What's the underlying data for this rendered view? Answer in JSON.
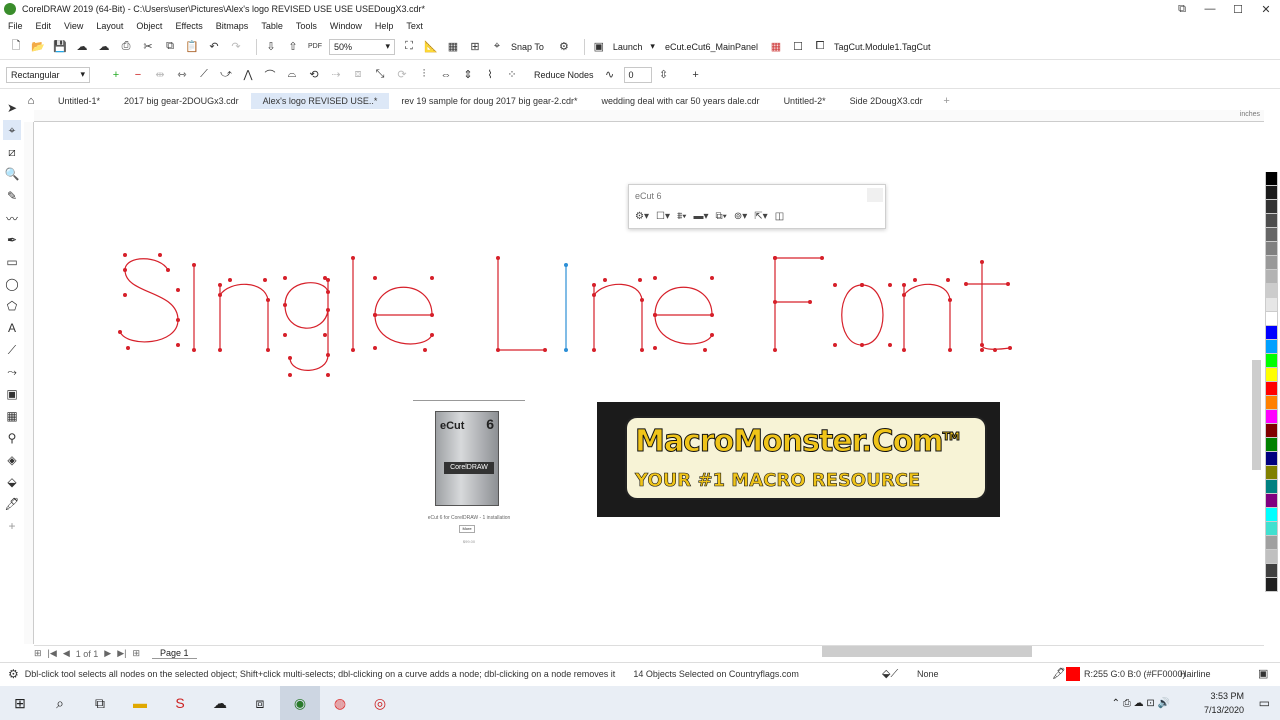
{
  "window": {
    "title": "CorelDRAW 2019 (64-Bit) - C:\\Users\\user\\Pictures\\Alex's logo REVISED USE USE USEDougX3.cdr*"
  },
  "menu": [
    "File",
    "Edit",
    "View",
    "Layout",
    "Object",
    "Effects",
    "Bitmaps",
    "Table",
    "Tools",
    "Window",
    "Help",
    "Text"
  ],
  "toolbar": {
    "zoom_value": "50%",
    "snap_label": "Snap To",
    "launch_label": "Launch",
    "ecut_panel_label": "eCut.eCut6_MainPanel",
    "tagcut_label": "TagCut.Module1.TagCut"
  },
  "property_bar": {
    "shape_mode": "Rectangular",
    "reduce_nodes_label": "Reduce Nodes",
    "smoothness_value": "0"
  },
  "tabs": [
    {
      "label": "Untitled-1*",
      "active": false
    },
    {
      "label": "2017 big gear-2DOUGx3.cdr",
      "active": false
    },
    {
      "label": "Alex's logo REVISED USE..*",
      "active": true
    },
    {
      "label": "rev 19 sample for doug 2017 big gear-2.cdr*",
      "active": false
    },
    {
      "label": "wedding deal with car 50 years dale.cdr",
      "active": false
    },
    {
      "label": "Untitled-2*",
      "active": false
    },
    {
      "label": "Side 2DougX3.cdr",
      "active": false
    }
  ],
  "ruler_units": "inches",
  "ecut_panel": {
    "title": "eCut 6"
  },
  "canvas": {
    "single_line_font_text": "Single Line Font",
    "product": {
      "box_label": "eCut",
      "box_number": "6",
      "box_brand": "CorelDRAW",
      "caption": "eCut 6 for CorelDRAW - 1 installation",
      "button": "More",
      "price": "$99.00"
    },
    "banner": {
      "line1": "MacroMonster.Com",
      "trademark": "TM",
      "line2": "YOUR #1 MACRO RESOURCE"
    }
  },
  "page_nav": {
    "page_of": "1 of 1",
    "page_tab": "Page 1"
  },
  "status": {
    "hint": "Dbl-click tool selects all nodes on the selected object; Shift+click multi-selects; dbl-clicking on a curve adds a node; dbl-clicking on a node removes it",
    "selection": "14 Objects Selected on Countryflags.com",
    "fill_label": "None",
    "outline_color": "R:255 G:0 B:0 (#FF0000)",
    "outline_width": "Hairline"
  },
  "taskbar": {
    "time": "3:53 PM",
    "date": "7/13/2020"
  },
  "colors": {
    "node_red": "#d6202a",
    "selected_blue": "#2c8fd6",
    "palette": [
      "#000000",
      "#1a1a1a",
      "#333333",
      "#4d4d4d",
      "#666666",
      "#808080",
      "#999999",
      "#b3b3b3",
      "#cccccc",
      "#e6e6e6",
      "#ffffff",
      "#0000ff",
      "#00a0ff",
      "#00ff00",
      "#ffff00",
      "#ff0000",
      "#ff8000",
      "#ff00ff",
      "#800000",
      "#008000",
      "#000080",
      "#808000",
      "#008080",
      "#800080",
      "#00ffff",
      "#40e0d0",
      "#a0a0a0",
      "#c0c0c0",
      "#404040",
      "#202020"
    ]
  }
}
